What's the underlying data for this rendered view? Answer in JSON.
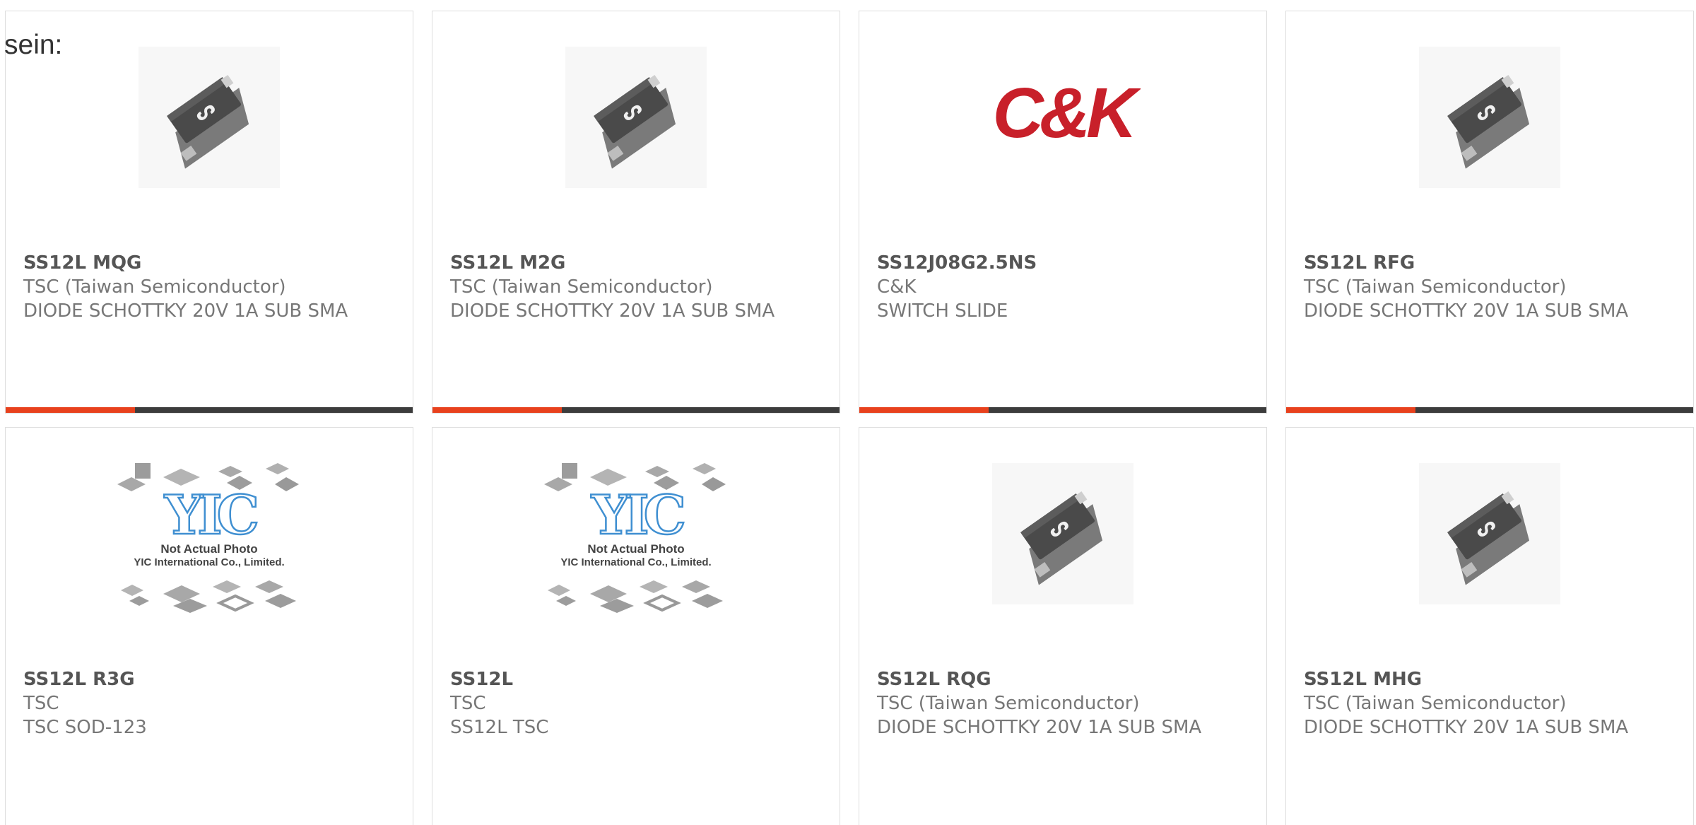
{
  "intro_text": "sein:",
  "colors": {
    "accent": "#e8411d",
    "bar_dark": "#3c3c3c",
    "card_border": "#dedede",
    "logo_red": "#c8202a",
    "yic_blue": "#3f8fd1"
  },
  "products": [
    {
      "part_number": "SS12L MQG",
      "manufacturer": "TSC (Taiwan Semiconductor)",
      "description": "DIODE SCHOTTKY 20V 1A SUB SMA",
      "image": "sma-diode-package"
    },
    {
      "part_number": "SS12L M2G",
      "manufacturer": "TSC (Taiwan Semiconductor)",
      "description": "DIODE SCHOTTKY 20V 1A SUB SMA",
      "image": "sma-diode-package"
    },
    {
      "part_number": "SS12J08G2.5NS",
      "manufacturer": "C&K",
      "description": "SWITCH SLIDE",
      "image": "ck-logo",
      "logo_text": "C&K"
    },
    {
      "part_number": "SS12L RFG",
      "manufacturer": "TSC (Taiwan Semiconductor)",
      "description": "DIODE SCHOTTKY 20V 1A SUB SMA",
      "image": "sma-diode-package"
    },
    {
      "part_number": "SS12L R3G",
      "manufacturer": "TSC",
      "description": "TSC SOD-123",
      "image": "yic-placeholder",
      "placeholder_logo": "YIC",
      "placeholder_line1": "Not Actual Photo",
      "placeholder_line2": "YIC International Co., Limited."
    },
    {
      "part_number": "SS12L",
      "manufacturer": "TSC",
      "description": "SS12L TSC",
      "image": "yic-placeholder",
      "placeholder_logo": "YIC",
      "placeholder_line1": "Not Actual Photo",
      "placeholder_line2": "YIC International Co., Limited."
    },
    {
      "part_number": "SS12L RQG",
      "manufacturer": "TSC (Taiwan Semiconductor)",
      "description": "DIODE SCHOTTKY 20V 1A SUB SMA",
      "image": "sma-diode-package"
    },
    {
      "part_number": "SS12L MHG",
      "manufacturer": "TSC (Taiwan Semiconductor)",
      "description": "DIODE SCHOTTKY 20V 1A SUB SMA",
      "image": "sma-diode-package"
    }
  ]
}
